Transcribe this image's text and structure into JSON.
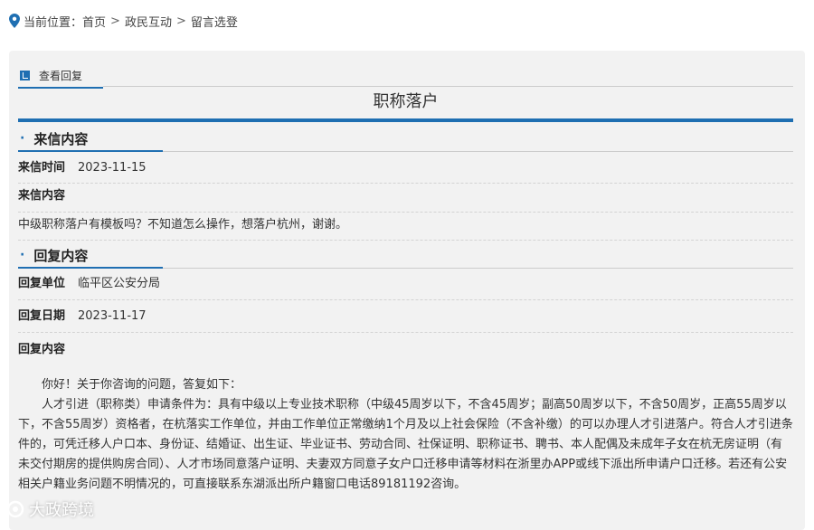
{
  "breadcrumb": {
    "prefix": "当前位置：",
    "items": [
      "首页",
      "政民互动",
      "留言选登"
    ],
    "sep": ">"
  },
  "tab": {
    "label": "查看回复"
  },
  "title": "职称落户",
  "letter": {
    "heading": "来信内容",
    "time_label": "来信时间",
    "time_value": "2023-11-15",
    "content_label": "来信内容",
    "content": "中级职称落户有模板吗？不知道怎么操作，想落户杭州，谢谢。"
  },
  "reply": {
    "heading": "回复内容",
    "unit_label": "回复单位",
    "unit_value": "临平区公安分局",
    "date_label": "回复日期",
    "date_value": "2023-11-17",
    "content_label": "回复内容",
    "paragraphs": [
      "你好！关于你咨询的问题，答复如下：",
      "人才引进（职称类）申请条件为：具有中级以上专业技术职称（中级45周岁以下，不含45周岁；副高50周岁以下，不含50周岁，正高55周岁以下，不含55周岁）资格者，在杭落实工作单位，并由工作单位正常缴纳1个月及以上社会保险（不含补缴）的可以办理人才引进落户。符合人才引进条件的，可凭迁移人户口本、身份证、结婚证、出生证、毕业证书、劳动合同、社保证明、职称证书、聘书、本人配偶及未成年子女在杭无房证明（有未交付期房的提供购房合同）、人才市场同意落户证明、夫妻双方同意子女户口迁移申请等材料在浙里办APP或线下派出所申请户口迁移。若还有公安相关户籍业务问题不明情况的，可直接联系东湖派出所户籍窗口电话89181192咨询。"
    ]
  },
  "watermark": "大政跨境",
  "colors": {
    "accent": "#1f6fb2",
    "panel": "#f2f2f2"
  }
}
